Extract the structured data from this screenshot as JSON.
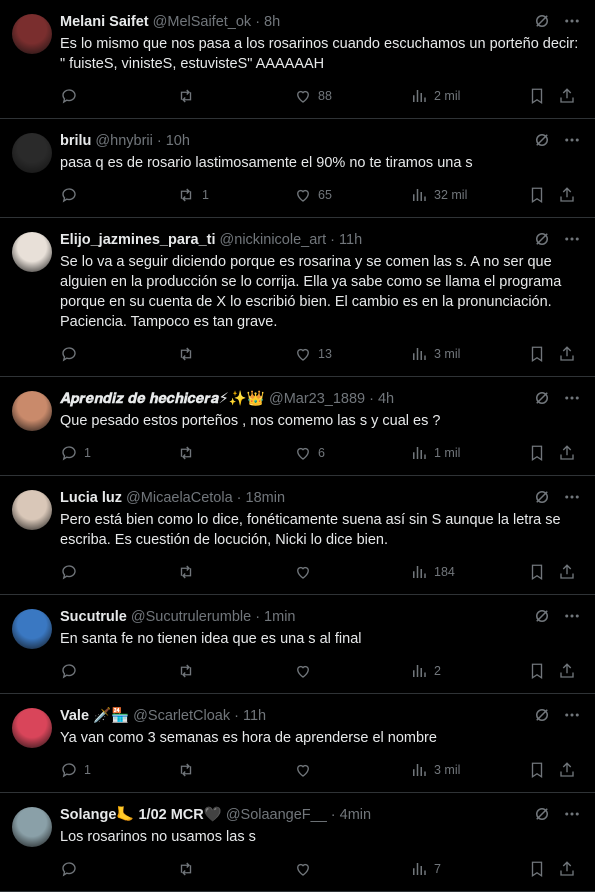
{
  "tweets": [
    {
      "name": "Melani Saifet",
      "handle": "@MelSaifet_ok",
      "time": "· 8h",
      "text": "Es lo mismo que nos pasa a los rosarinos cuando escuchamos un porteño decir: \" fuisteS, vinisteS, estuvisteS\" AAAAAAH",
      "replies": "",
      "retweets": "",
      "likes": "88",
      "views": "2 mil",
      "avatar_color": "#7a2e2e"
    },
    {
      "name": "brilu",
      "handle": "@hnybrii",
      "time": "· 10h",
      "text": "pasa q es de rosario lastimosamente el 90% no te tiramos una s",
      "replies": "",
      "retweets": "1",
      "likes": "65",
      "views": "32 mil",
      "avatar_color": "#2a2a2a"
    },
    {
      "name": "Elijo_jazmines_para_ti",
      "handle": "@nickinicole_art",
      "time": "· 11h",
      "text": "Se lo va a seguir diciendo porque es rosarina y se comen las s. A no ser que alguien en la producción se lo corrija. Ella ya sabe como se llama el programa porque en su cuenta de X  lo escribió bien. El cambio es en la pronunciación. Paciencia. Tampoco es tan grave.",
      "replies": "",
      "retweets": "",
      "likes": "13",
      "views": "3 mil",
      "avatar_color": "#e8e0d8"
    },
    {
      "name": "𝑨𝒑𝒓𝒆𝒏𝒅𝒊𝒛 𝒅𝒆 𝒉𝒆𝒄𝒉𝒊𝒄𝒆𝒓𝒂⚡✨👑",
      "handle": "@Mar23_1889",
      "time": "· 4h",
      "text": "Que pesado estos porteños , nos comemo las s y cual es ?",
      "replies": "1",
      "retweets": "",
      "likes": "6",
      "views": "1 mil",
      "avatar_color": "#c98a6b"
    },
    {
      "name": "Lucia luz",
      "handle": "@MicaelaCetola",
      "time": "· 18min",
      "text": "Pero está bien como lo dice, fonéticamente suena así sin S aunque la letra se escriba. Es cuestión de locución, Nicki lo dice bien.",
      "replies": "",
      "retweets": "",
      "likes": "",
      "views": "184",
      "avatar_color": "#d9c7b8"
    },
    {
      "name": "Sucutrule",
      "handle": "@Sucutrulerumble",
      "time": "· 1min",
      "text": "En santa fe no tienen idea que es una s al final",
      "replies": "",
      "retweets": "",
      "likes": "",
      "views": "2",
      "avatar_color": "#3a78c2"
    },
    {
      "name": "Vale 🗡️🏪",
      "handle": "@ScarletCloak",
      "time": "· 11h",
      "text": "Ya van como 3 semanas es hora de aprenderse el nombre",
      "replies": "1",
      "retweets": "",
      "likes": "",
      "views": "3 mil",
      "avatar_color": "#d9455a"
    },
    {
      "name": "Solange🦶 1/02 MCR🖤",
      "handle": "@SolaangeF__",
      "time": "· 4min",
      "text": "Los rosarinos no usamos las s",
      "replies": "",
      "retweets": "",
      "likes": "",
      "views": "7",
      "avatar_color": "#8aa0a8"
    }
  ]
}
